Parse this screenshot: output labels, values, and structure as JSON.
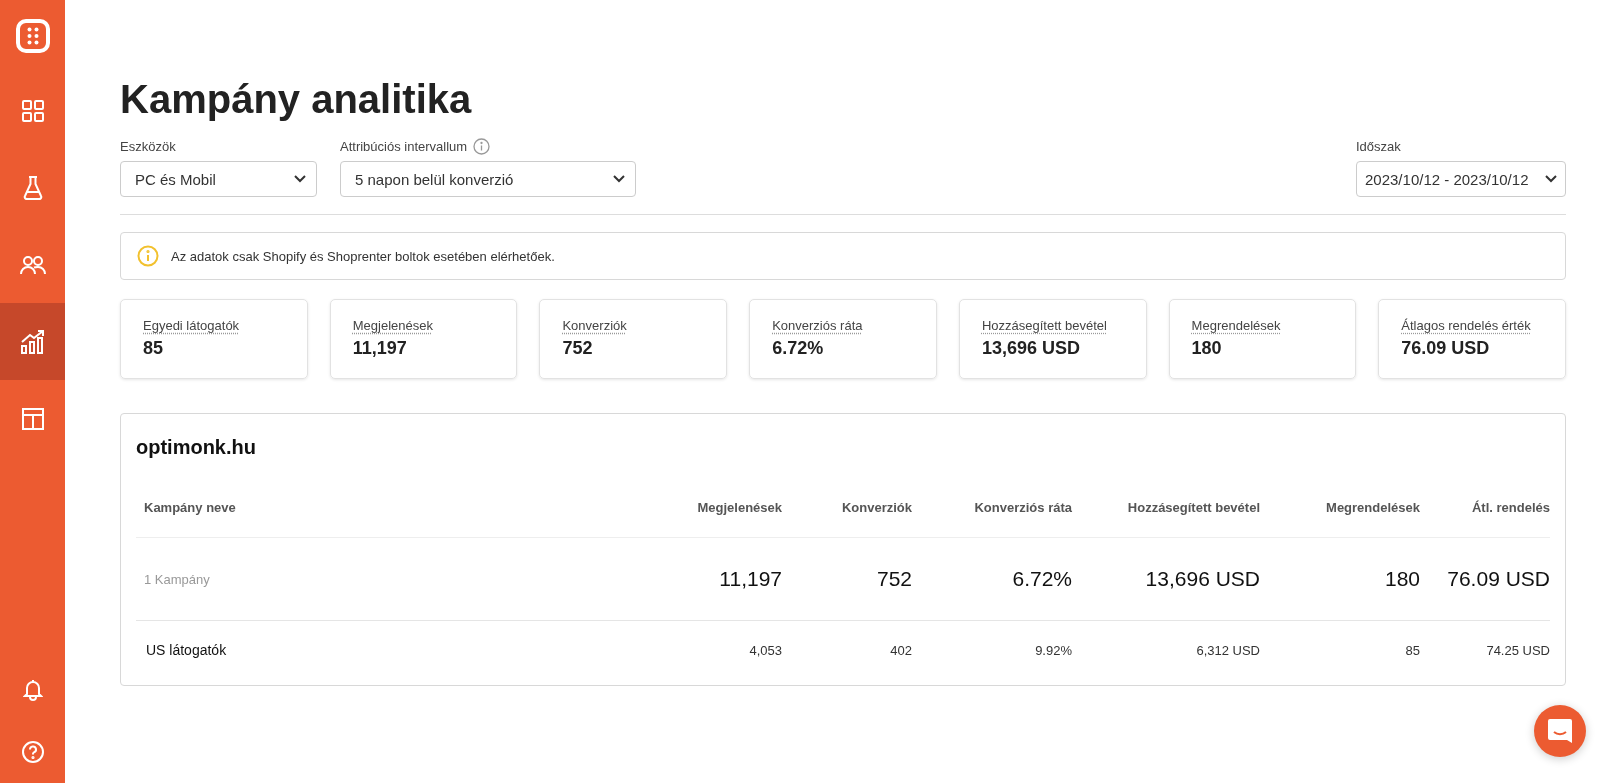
{
  "sidebar": {
    "items": [
      {
        "selected": false
      },
      {
        "selected": false
      },
      {
        "selected": false
      },
      {
        "selected": true
      },
      {
        "selected": false
      }
    ]
  },
  "title": "Kampány analitika",
  "filters": [
    {
      "label": "Eszközök",
      "value": "PC és Mobil",
      "info": false
    },
    {
      "label": "Attribúciós intervallum",
      "value": "5 napon belül konverzió",
      "info": true
    }
  ],
  "period": {
    "label": "Időszak",
    "value": "2023/10/12 - 2023/10/12"
  },
  "notice": "Az adatok csak Shopify és Shoprenter boltok esetében elérhetőek.",
  "stats": [
    {
      "label": "Egyedi látogatók",
      "value": "85"
    },
    {
      "label": "Megjelenések",
      "value": "11,197"
    },
    {
      "label": "Konverziók",
      "value": "752"
    },
    {
      "label": "Konverziós ráta",
      "value": "6.72%"
    },
    {
      "label": "Hozzásegített bevétel",
      "value": "13,696 USD"
    },
    {
      "label": "Megrendelések",
      "value": "180"
    },
    {
      "label": "Átlagos rendelés érték",
      "value": "76.09 USD"
    }
  ],
  "table": {
    "title": "optimonk.hu",
    "columns": [
      "Kampány neve",
      "Megjelenések",
      "Konverziók",
      "Konverziós ráta",
      "Hozzásegített bevétel",
      "Megrendelések",
      "Átl. rendelés"
    ],
    "rows": [
      {
        "kind": "summary",
        "cells": [
          "1 Kampány",
          "11,197",
          "752",
          "6.72%",
          "13,696 USD",
          "180",
          "76.09 USD"
        ]
      },
      {
        "kind": "campaign",
        "cells": [
          "US látogatók",
          "4,053",
          "402",
          "9.92%",
          "6,312 USD",
          "85",
          "74.25 USD"
        ]
      }
    ]
  }
}
